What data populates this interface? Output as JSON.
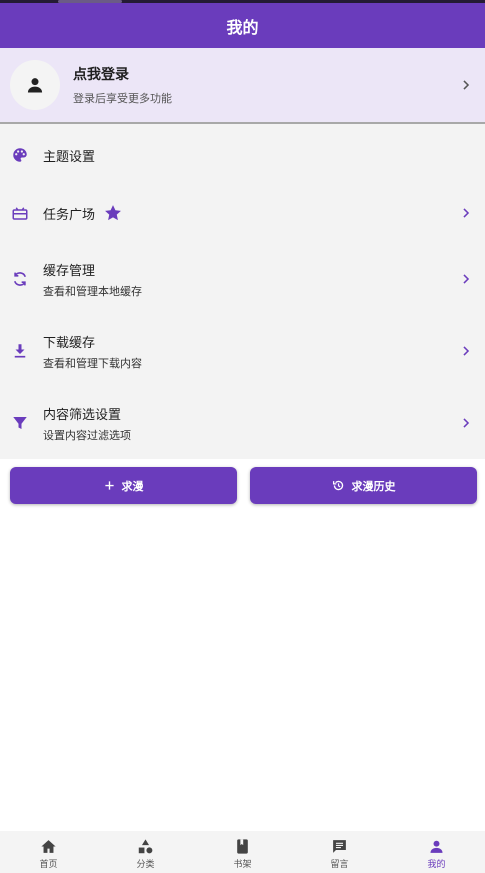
{
  "header": {
    "title": "我的"
  },
  "login": {
    "title": "点我登录",
    "subtitle": "登录后享受更多功能"
  },
  "menu": {
    "items": [
      {
        "label": "主题设置",
        "icon": "palette-icon"
      },
      {
        "label": "任务广场",
        "icon": "gift-icon",
        "badge_icon": "star-icon"
      },
      {
        "label": "缓存管理",
        "sublabel": "查看和管理本地缓存",
        "icon": "sync-icon"
      },
      {
        "label": "下载缓存",
        "sublabel": "查看和管理下载内容",
        "icon": "download-icon"
      },
      {
        "label": "内容筛选设置",
        "sublabel": "设置内容过滤选项",
        "icon": "filter-icon"
      }
    ]
  },
  "buttons": {
    "request": "求漫",
    "request_history": "求漫历史"
  },
  "nav": {
    "items": [
      {
        "label": "首页",
        "icon": "home-icon"
      },
      {
        "label": "分类",
        "icon": "category-icon"
      },
      {
        "label": "书架",
        "icon": "book-icon"
      },
      {
        "label": "留言",
        "icon": "message-icon"
      },
      {
        "label": "我的",
        "icon": "person-icon",
        "active": true
      }
    ]
  },
  "colors": {
    "accent": "#6a3cbc",
    "login_bg": "#ece6f7",
    "menu_bg": "#f3f3f3"
  }
}
